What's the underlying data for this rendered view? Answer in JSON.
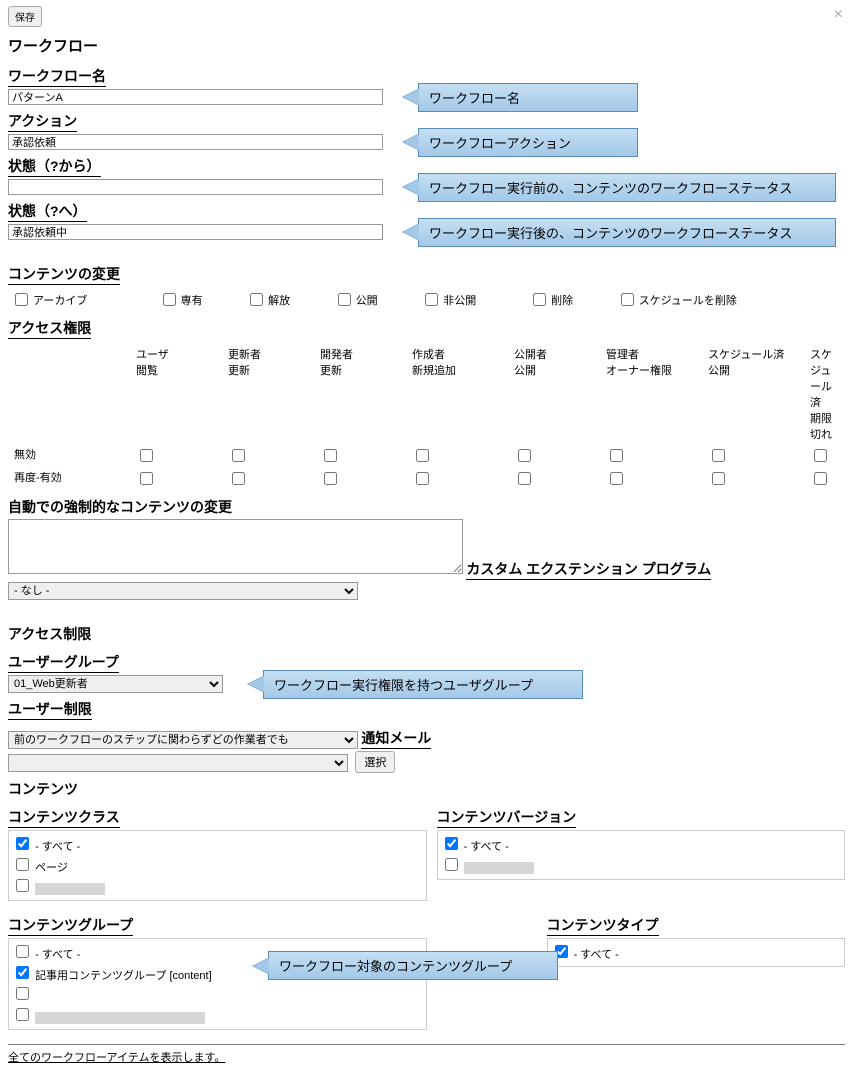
{
  "buttons": {
    "save": "保存",
    "close": "×",
    "select": "選択"
  },
  "headings": {
    "workflow": "ワークフロー",
    "workflow_name": "ワークフロー名",
    "action": "アクション",
    "state_from": "状態（?から）",
    "state_to": "状態（?へ）",
    "content_change": "コンテンツの変更",
    "access_perm": "アクセス権限",
    "auto_force_change": "自動での強制的なコンテンツの変更",
    "custom_ext": "カスタム エクステンション プログラム",
    "access_restrict": "アクセス制限",
    "user_group": "ユーザーグループ",
    "user_restrict": "ユーザー制限",
    "notify_mail": "通知メール",
    "content": "コンテンツ",
    "content_class": "コンテンツクラス",
    "content_version": "コンテンツバージョン",
    "content_group": "コンテンツグループ",
    "content_type": "コンテンツタイプ"
  },
  "values": {
    "workflow_name": "パターンA",
    "action": "承認依頼",
    "state_from": "",
    "state_to": "承認依頼中",
    "custom_ext": "- なし -",
    "user_group": "01_Web更新者",
    "user_restrict": "前のワークフローのステップに関わらずどの作業者でも",
    "all": "- すべて -",
    "page": "ページ",
    "article_group": "記事用コンテンツグループ [content]"
  },
  "callouts": {
    "workflow_name": "ワークフロー名",
    "action": "ワークフローアクション",
    "state_from": "ワークフロー実行前の、コンテンツのワークフローステータス",
    "state_to": "ワークフロー実行後の、コンテンツのワークフローステータス",
    "user_group": "ワークフロー実行権限を持つユーザグループ",
    "content_group": "ワークフロー対象のコンテンツグループ"
  },
  "content_change_options": {
    "archive": "アーカイブ",
    "exclusive": "専有",
    "release": "解放",
    "publish": "公開",
    "unpublish": "非公開",
    "delete": "削除",
    "delete_schedule": "スケジュールを削除"
  },
  "perm_cols": {
    "user_view": {
      "l1": "ユーザ",
      "l2": "閲覧"
    },
    "updater_update": {
      "l1": "更新者",
      "l2": "更新"
    },
    "dev_update": {
      "l1": "開発者",
      "l2": "更新"
    },
    "creator_new": {
      "l1": "作成者",
      "l2": "新規追加"
    },
    "publisher_pub": {
      "l1": "公開者",
      "l2": "公開"
    },
    "admin_owner": {
      "l1": "管理者",
      "l2": "オーナー権限"
    },
    "sched_pub": {
      "l1": "スケジュール済",
      "l2": "公開"
    },
    "sched_exp": {
      "l1": "スケジュール済",
      "l2": "期限切れ"
    }
  },
  "perm_rows": {
    "disable": "無効",
    "reenable": "再度-有効"
  },
  "footer_link": "全てのワークフローアイテムを表示します。"
}
